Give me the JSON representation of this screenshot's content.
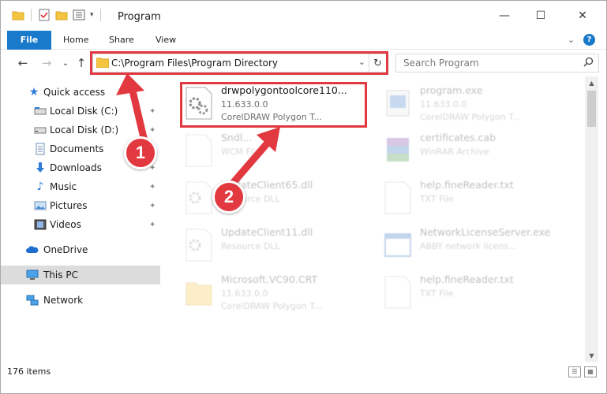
{
  "window": {
    "title": "Program",
    "controls": {
      "minimize": "—",
      "maximize": "☐",
      "close": "✕"
    }
  },
  "ribbon": {
    "tabs": [
      "File",
      "Home",
      "Share",
      "View"
    ],
    "collapse": "⌄",
    "help": "?"
  },
  "nav": {
    "back": "←",
    "forward": "→",
    "recent": "⌄",
    "up": "↑",
    "address": "C:\\Program Files\\Program Directory",
    "address_dropdown": "⌄",
    "refresh": "↻",
    "search_placeholder": "Search Program",
    "search_icon": "search-icon"
  },
  "sidebar": {
    "items": [
      {
        "label": "Quick access",
        "icon": "star-icon"
      },
      {
        "label": "Local Disk (C:)",
        "icon": "drive-icon",
        "pinned": true
      },
      {
        "label": "Local Disk (D:)",
        "icon": "drive-icon",
        "pinned": true
      },
      {
        "label": "Documents",
        "icon": "documents-icon",
        "pinned": true
      },
      {
        "label": "Downloads",
        "icon": "downloads-icon",
        "pinned": true
      },
      {
        "label": "Music",
        "icon": "music-icon",
        "pinned": true
      },
      {
        "label": "Pictures",
        "icon": "pictures-icon",
        "pinned": true
      },
      {
        "label": "Videos",
        "icon": "videos-icon",
        "pinned": true
      },
      {
        "label": "OneDrive",
        "icon": "cloud-icon"
      },
      {
        "label": "This PC",
        "icon": "computer-icon",
        "selected": true
      },
      {
        "label": "Network",
        "icon": "network-icon"
      }
    ],
    "pin_glyph": "📌"
  },
  "files": [
    {
      "name": "drwpolygontoolcore110...",
      "line1": "11.633.0.0",
      "line2": "CorelDRAW Polygon T...",
      "icon": "dll-gear-icon",
      "highlighted": true
    },
    {
      "name": "program.exe",
      "line1": "11.633.0.0",
      "line2": "CorelDRAW Polygon T...",
      "icon": "exe-icon"
    },
    {
      "name": "Sndl...",
      "line1": "WCM File",
      "line2": "",
      "icon": "file-icon"
    },
    {
      "name": "certificates.cab",
      "line1": "WinRAR Archive",
      "line2": "",
      "icon": "winrar-icon"
    },
    {
      "name": "UpdateClient65.dll",
      "line1": "Resource DLL",
      "line2": "",
      "icon": "dll-gear-icon"
    },
    {
      "name": "help.fineReader.txt",
      "line1": "TXT File",
      "line2": "",
      "icon": "txt-icon"
    },
    {
      "name": "UpdateClient11.dll",
      "line1": "Resource DLL",
      "line2": "",
      "icon": "dll-gear-icon"
    },
    {
      "name": "NetworkLicenseServer.exe",
      "line1": "ABBY network licens...",
      "line2": "",
      "icon": "app-window-icon"
    },
    {
      "name": "Microsoft.VC90.CRT",
      "line1": "11.633.0.0",
      "line2": "CorelDRAW Polygon T...",
      "icon": "folder-icon"
    },
    {
      "name": "help.fineReader.txt",
      "line1": "TXT File",
      "line2": "",
      "icon": "txt-icon"
    }
  ],
  "status": {
    "count": "176 items"
  },
  "annotations": {
    "step1": "1",
    "step2": "2",
    "color": "#e2383f"
  },
  "colors": {
    "accent": "#1979ca",
    "highlight": "#e2383f",
    "selected": "#dcdcdc"
  }
}
